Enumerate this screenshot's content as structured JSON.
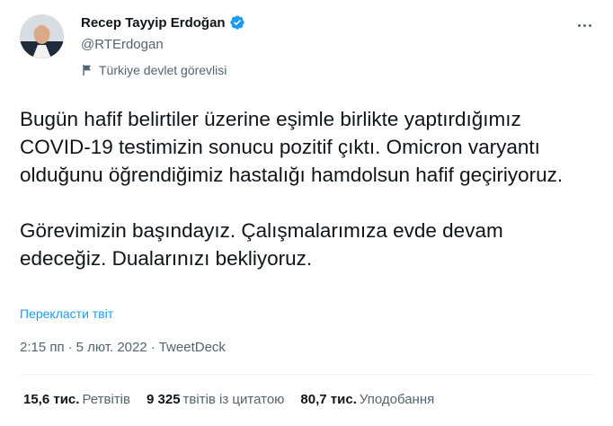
{
  "author": {
    "name": "Recep Tayyip Erdoğan",
    "handle": "@RTErdogan",
    "label": "Türkiye devlet görevlisi"
  },
  "tweet": {
    "paragraph1": "Bugün hafif belirtiler üzerine eşimle birlikte yaptırdığımız COVID-19 testimizin sonucu pozitif çıktı. Omicron varyantı olduğunu öğrendiğimiz hastalığı hamdolsun hafif geçiriyoruz.",
    "paragraph2": "Görevimizin başındayız. Çalışmalarımıza evde devam edeceğiz. Dualarınızı bekliyoruz.",
    "translate": "Перекласти твіт",
    "time": "2:15 пп",
    "separator": "·",
    "date": "5 лют. 2022",
    "source": "TweetDeck"
  },
  "stats": {
    "retweets_value": "15,6 тис.",
    "retweets_label": "Ретвітів",
    "quotes_value": "9 325",
    "quotes_label": "твітів із цитатою",
    "likes_value": "80,7 тис.",
    "likes_label": "Уподобання"
  },
  "icons": {
    "verified": "verified-badge-icon",
    "label": "flag-icon",
    "more": "more-icon"
  },
  "colors": {
    "accent": "#1d9bf0",
    "secondary_text": "#536471",
    "text": "#0f1419"
  }
}
